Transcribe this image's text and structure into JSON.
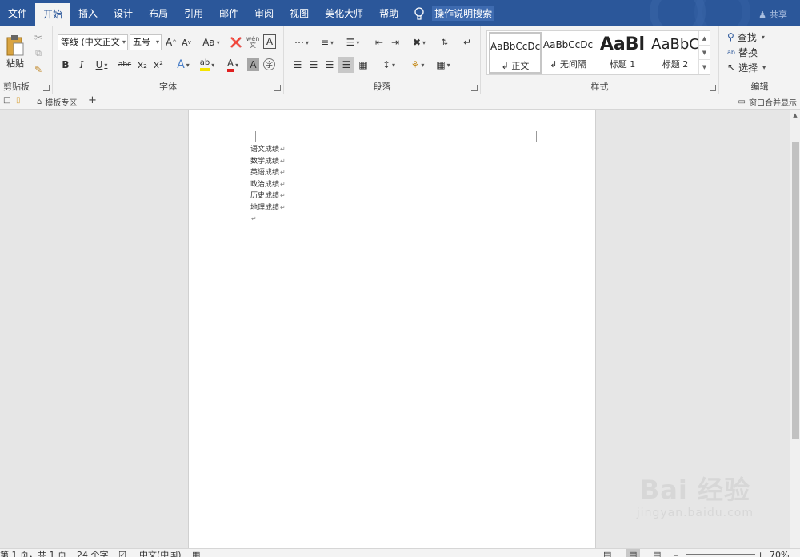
{
  "tabs": [
    "文件",
    "开始",
    "插入",
    "设计",
    "布局",
    "引用",
    "邮件",
    "审阅",
    "视图",
    "美化大师",
    "帮助"
  ],
  "active_tab": "开始",
  "tell_me": "操作说明搜索",
  "share": "共享",
  "clipboard": {
    "paste": "粘贴",
    "label": "剪贴板"
  },
  "font": {
    "name": "等线 (中文正文",
    "size": "五号",
    "grow": "A",
    "shrink": "A",
    "case": "Aa",
    "pinyin": "wén",
    "border_char": "A",
    "bold": "B",
    "italic": "I",
    "underline": "U",
    "strike": "abc",
    "sub": "x₂",
    "sup": "x²",
    "effects": "A",
    "highlight": "ab",
    "color": "A",
    "shade": "A",
    "enclose": "字",
    "label": "字体"
  },
  "paragraph": {
    "label": "段落"
  },
  "styles": {
    "label": "样式",
    "items": [
      {
        "sample": "AaBbCcDc",
        "name": "↲ 正文"
      },
      {
        "sample": "AaBbCcDc",
        "name": "↲ 无间隔"
      },
      {
        "sample": "AaBl",
        "name": "标题 1"
      },
      {
        "sample": "AaBbC",
        "name": "标题 2"
      }
    ]
  },
  "editing": {
    "find": "查找",
    "replace": "替换",
    "select": "选择",
    "label": "编辑"
  },
  "docbar": {
    "template": "模板专区",
    "merge": "窗口合并显示"
  },
  "document": {
    "lines": [
      "语文成绩",
      "数学成绩",
      "英语成绩",
      "政治成绩",
      "历史成绩",
      "地理成绩",
      ""
    ],
    "para_mark": "↵"
  },
  "status": {
    "page": "第 1 页，共 1 页",
    "words": "24 个字",
    "lang": "中文(中国)",
    "zoom": "70%"
  },
  "watermark": {
    "logo": "Bai 经验",
    "url": "jingyan.baidu.com"
  }
}
